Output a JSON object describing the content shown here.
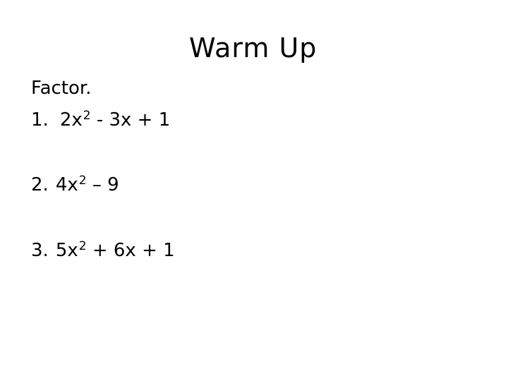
{
  "slide": {
    "title": "Warm Up",
    "instruction": "Factor.",
    "problems": [
      {
        "number": "1.",
        "coef": "2x",
        "exponent": "2",
        "rest": " - 3x + 1"
      },
      {
        "number": "2.",
        "coef": "4x",
        "exponent": "2",
        "rest": " – 9"
      },
      {
        "number": "3.",
        "coef": "5x",
        "exponent": "2",
        "rest": " + 6x + 1"
      }
    ]
  }
}
